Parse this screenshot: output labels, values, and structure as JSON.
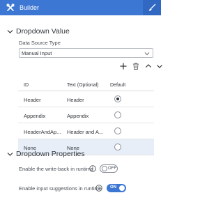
{
  "header": {
    "title": "Builder",
    "left_icon": "tools-icon",
    "right_icon": "paintbrush-icon"
  },
  "dropdown_value": {
    "section_title": "Dropdown Value",
    "data_source_label": "Data Source Type",
    "data_source_value": "Manual Input",
    "toolbar": [
      "add-icon",
      "delete-icon",
      "move-up-icon",
      "move-down-icon"
    ],
    "table": {
      "columns": [
        "ID",
        "Text (Optional)",
        "Default"
      ],
      "rows": [
        {
          "id": "Header",
          "text": "Header",
          "default": true
        },
        {
          "id": "Appendix",
          "text": "Appendix",
          "default": false
        },
        {
          "id": "HeaderAndAp...",
          "text": "Header and A...",
          "default": false
        },
        {
          "id": "None",
          "text": "None",
          "default": false
        }
      ]
    }
  },
  "dropdown_properties": {
    "section_title": "Dropdown Properties",
    "writeback_label": "Enable the write-back in runtime",
    "writeback_state": "OFF",
    "suggestions_label": "Enable input suggestions in runtime",
    "suggestions_state": "ON"
  },
  "colors": {
    "header_bg": "#3d77d4",
    "accent": "#3d77d4",
    "selected_row": "#e8eef7"
  }
}
